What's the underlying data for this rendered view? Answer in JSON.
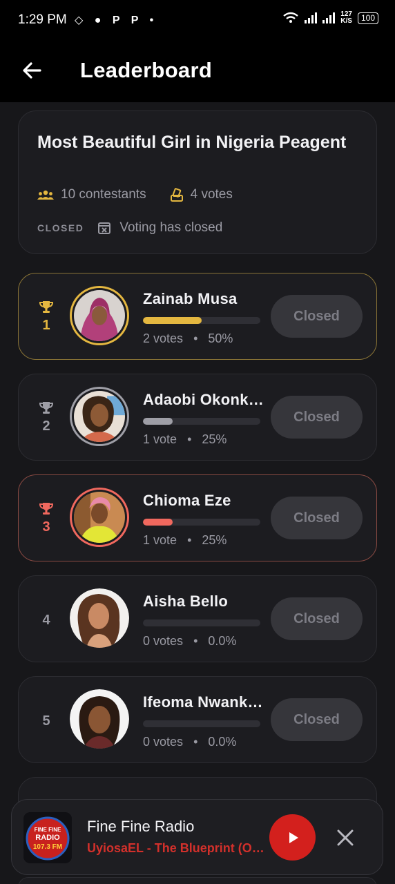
{
  "status_bar": {
    "time": "1:29 PM",
    "notification_icons": [
      "game-controller-icon",
      "chat-icon",
      "p-icon",
      "p-icon",
      "dot-icon"
    ],
    "net_speed_value": "127",
    "net_speed_unit": "K/S",
    "battery": "100"
  },
  "app_bar": {
    "title": "Leaderboard"
  },
  "contest": {
    "title": "Most Beautiful Girl in Nigeria Peagent",
    "contestants": "10 contestants",
    "votes": "4 votes",
    "status_tag": "CLOSED",
    "status_text": "Voting has closed"
  },
  "colors": {
    "gold": "#e4b740",
    "silver": "#9e9ea6",
    "bronze": "#f0685e",
    "accent_red": "#d3201d"
  },
  "leaderboard": [
    {
      "rank": "1",
      "name": "Zainab Musa",
      "votes": "2 votes",
      "percent": "50%",
      "share": 0.5,
      "button": "Closed",
      "trophy": true
    },
    {
      "rank": "2",
      "name": "Adaobi Okonkwo",
      "votes": "1 vote",
      "percent": "25%",
      "share": 0.25,
      "button": "Closed",
      "trophy": true
    },
    {
      "rank": "3",
      "name": "Chioma Eze",
      "votes": "1 vote",
      "percent": "25%",
      "share": 0.25,
      "button": "Closed",
      "trophy": true
    },
    {
      "rank": "4",
      "name": "Aisha Bello",
      "votes": "0 votes",
      "percent": "0.0%",
      "share": 0,
      "button": "Closed",
      "trophy": false
    },
    {
      "rank": "5",
      "name": "Ifeoma Nwankwo",
      "votes": "0 votes",
      "percent": "0.0%",
      "share": 0,
      "button": "Closed",
      "trophy": false
    }
  ],
  "separator": "•",
  "player": {
    "title": "Fine Fine Radio",
    "subtitle": "UyiosaEL - The Blueprint (Official Audio)",
    "logo_text_top": "FINE FINE",
    "logo_text_mid": "RADIO",
    "logo_text_freq": "107.3 FM"
  }
}
